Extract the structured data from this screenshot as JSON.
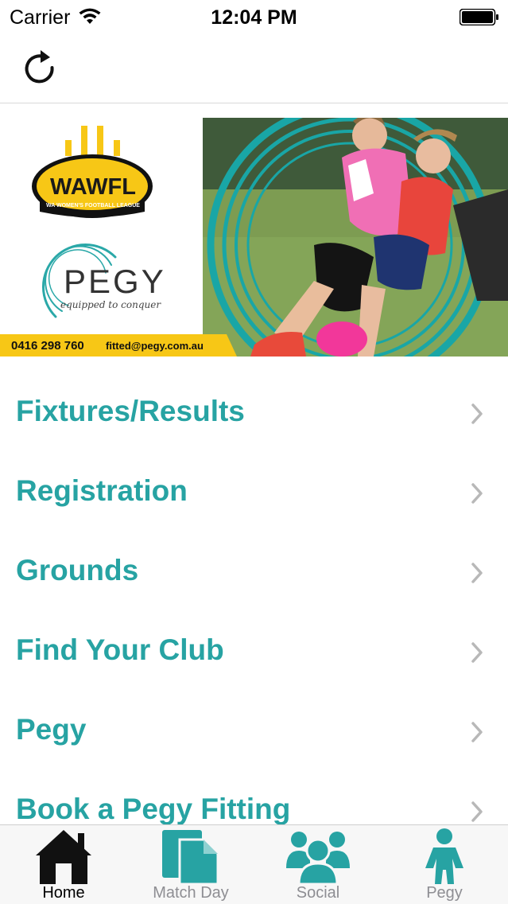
{
  "status_bar": {
    "carrier": "Carrier",
    "time": "12:04 PM"
  },
  "nav": {
    "refresh_icon": "refresh-icon"
  },
  "banner": {
    "league_name": "WAWFL",
    "league_full_name": "WA WOMEN'S FOOTBALL LEAGUE",
    "sponsor_name": "PEGY",
    "sponsor_tagline": "equipped to conquer",
    "phone": "0416 298 760",
    "email": "fitted@pegy.com.au"
  },
  "menu": {
    "items": [
      {
        "label": "Fixtures/Results"
      },
      {
        "label": "Registration"
      },
      {
        "label": "Grounds"
      },
      {
        "label": "Find Your Club"
      },
      {
        "label": "Pegy"
      },
      {
        "label": "Book a Pegy Fitting"
      }
    ]
  },
  "tab_bar": {
    "tabs": [
      {
        "label": "Home",
        "icon": "home-icon",
        "active": true
      },
      {
        "label": "Match Day",
        "icon": "document-icon",
        "active": false
      },
      {
        "label": "Social",
        "icon": "group-icon",
        "active": false
      },
      {
        "label": "Pegy",
        "icon": "person-icon",
        "active": false
      }
    ]
  },
  "colors": {
    "accent": "#27a3a3",
    "banner_yellow": "#f7c716",
    "tab_inactive": "#8e8e93"
  }
}
